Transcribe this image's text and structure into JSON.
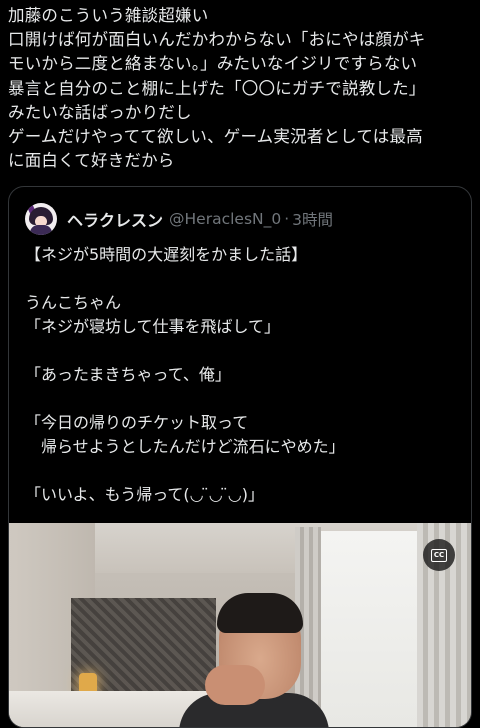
{
  "tweet": {
    "lines": [
      "加藤のこういう雑談超嫌い",
      "口開けば何が面白いんだかわからない「おにやは顔がキ",
      "モいから二度と絡まない。」みたいなイジリですらない",
      "暴言と自分のこと棚に上げた「〇〇にガチで説教した」",
      "みたいな話ばっかりだし",
      "ゲームだけやってて欲しい、ゲーム実況者としては最高",
      "に面白くて好きだから"
    ]
  },
  "quote": {
    "display_name": "ヘラクレスン",
    "handle": "@HeraclesN_0",
    "separator": "·",
    "time": "3時間",
    "lines": [
      "【ネジが5時間の大遅刻をかました話】",
      "",
      "うんこちゃん",
      "「ネジが寝坊して仕事を飛ばして」",
      "",
      "「あったまきちゃって、俺」",
      "",
      "「今日の帰りのチケット取って",
      "　帰らせようとしたんだけど流石にやめた」",
      "",
      "「いいよ、もう帰って(◡ ̈◡ ̈◡)」"
    ]
  },
  "media": {
    "cc_label": "CC"
  }
}
